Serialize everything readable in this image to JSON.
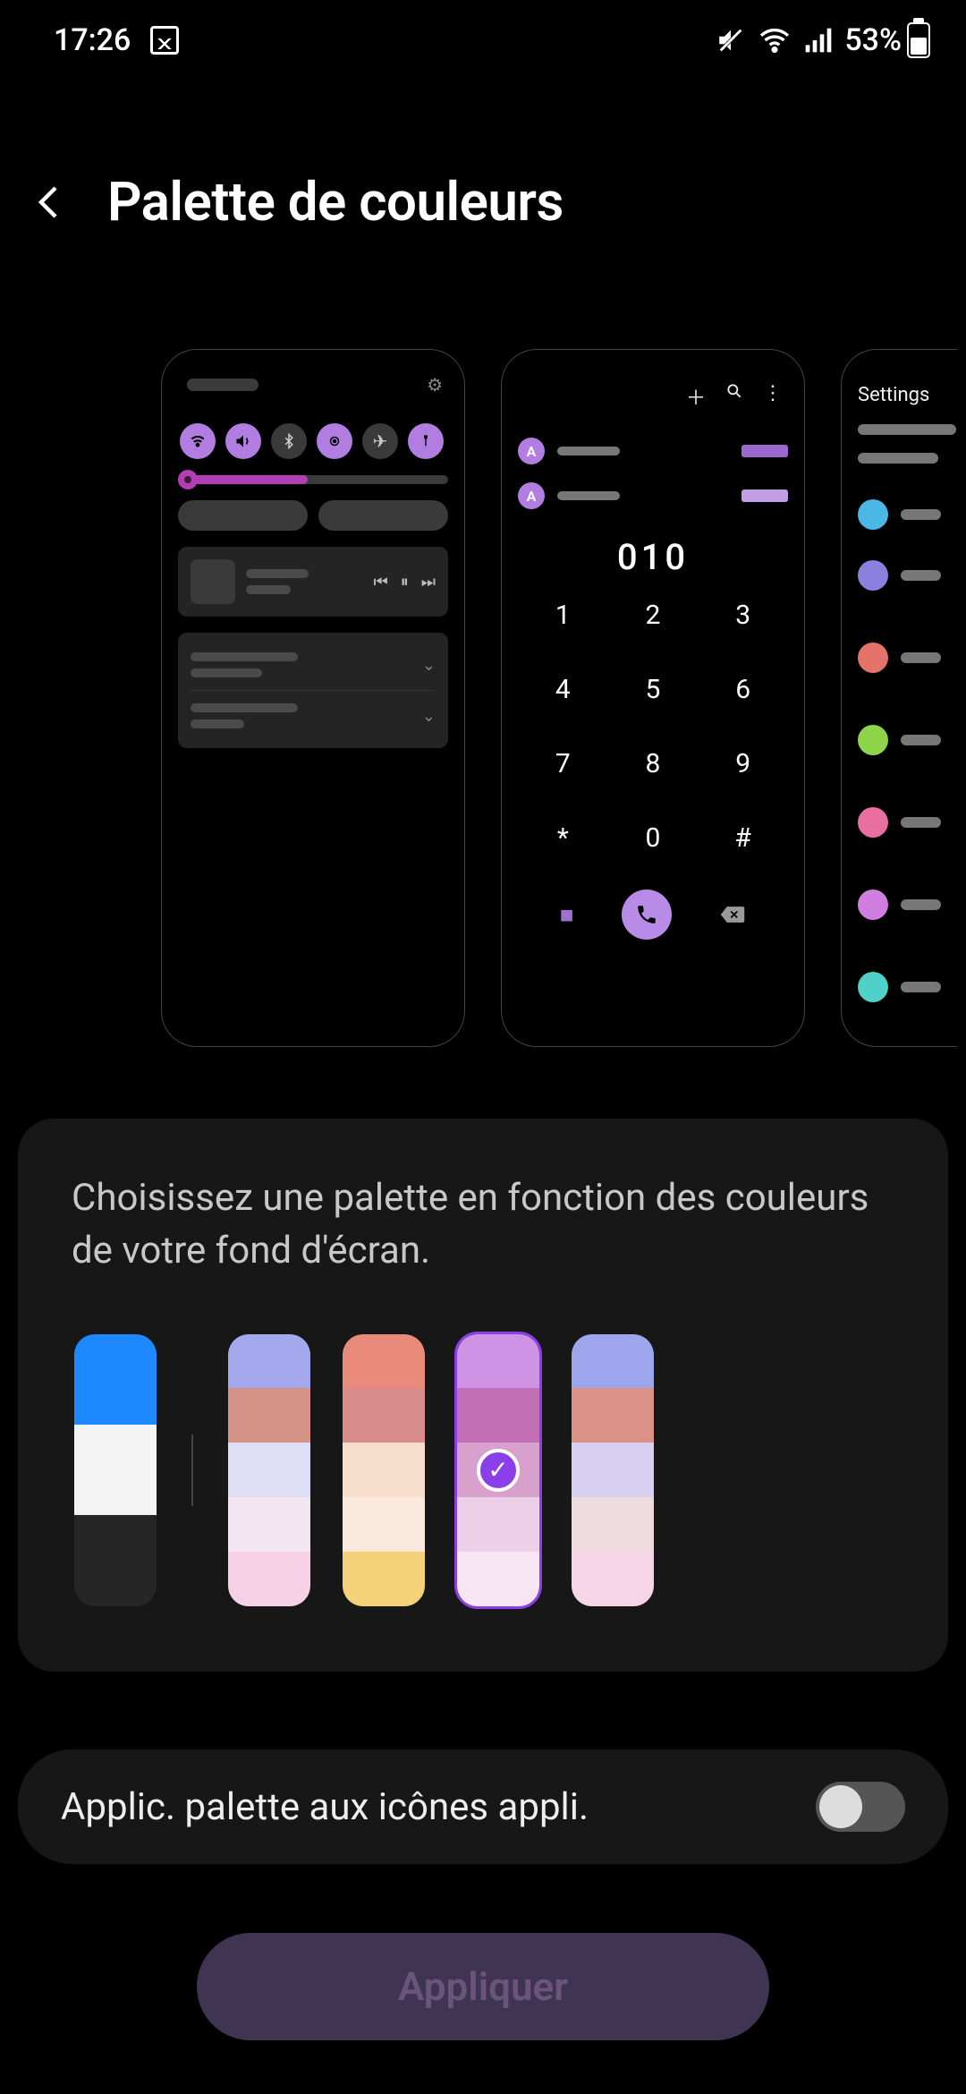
{
  "statusbar": {
    "time": "17:26",
    "battery_pct": "53%"
  },
  "header": {
    "title": "Palette de couleurs"
  },
  "preview": {
    "dialer": {
      "avatar_initial": "A",
      "typed": "010",
      "keys": [
        "1",
        "2",
        "3",
        "4",
        "5",
        "6",
        "7",
        "8",
        "9",
        "*",
        "0",
        "#"
      ]
    },
    "settings_label": "Settings"
  },
  "panel": {
    "description": "Choisissez une palette en fonction des couleurs de votre fond d'écran.",
    "swatches": [
      {
        "colors": [
          "#1e88ff",
          "#f4f4f4",
          "#262626"
        ]
      },
      {
        "colors": [
          "#a3a9ec",
          "#d59288",
          "#dedef7",
          "#f2e6f0",
          "#f7d2e6"
        ]
      },
      {
        "colors": [
          "#ea8a7a",
          "#d98c8c",
          "#f7decc",
          "#fbe9de",
          "#f4d27a"
        ]
      },
      {
        "colors": [
          "#cf93e6",
          "#c36fb6",
          "#d8a0cc",
          "#eecfe8",
          "#f8e5f3"
        ],
        "selected": true
      },
      {
        "colors": [
          "#9da5ec",
          "#db9088",
          "#d7cfef",
          "#efdce1",
          "#f6d6e6"
        ]
      }
    ]
  },
  "toggle": {
    "label": "Applic. palette aux icônes appli.",
    "on": false
  },
  "apply_button": "Appliquer",
  "settings_icon_colors": [
    "#4bb7e6",
    "#8b7fe0",
    "#e6736b",
    "#8fd54a",
    "#e86fa0",
    "#d07fe0",
    "#4fd0c8"
  ]
}
